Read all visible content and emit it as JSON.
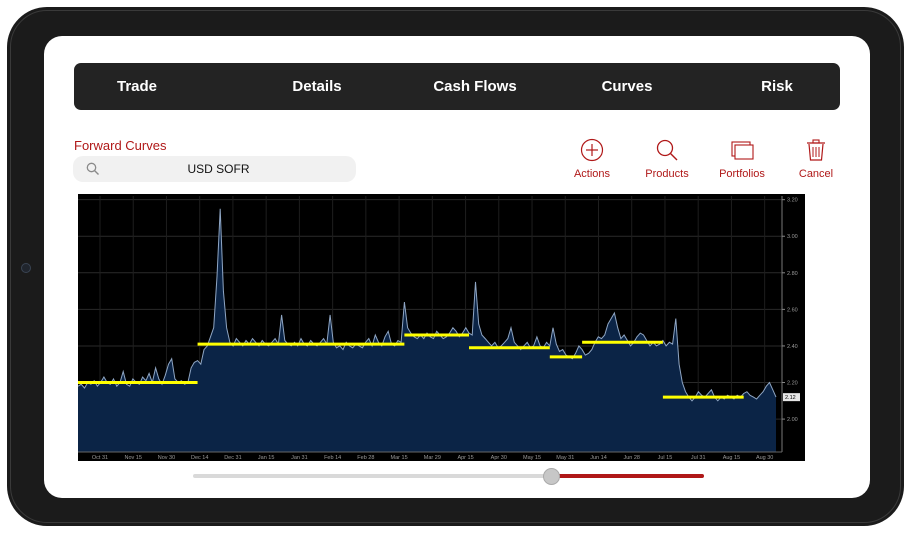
{
  "tabs": [
    {
      "label": "Trade"
    },
    {
      "label": "Details"
    },
    {
      "label": "Cash Flows"
    },
    {
      "label": "Curves"
    },
    {
      "label": "Risk"
    }
  ],
  "section": {
    "title": "Forward Curves"
  },
  "search": {
    "value": "USD SOFR",
    "icon": "search-icon"
  },
  "actions": [
    {
      "label": "Actions",
      "icon": "plus-circle-icon"
    },
    {
      "label": "Products",
      "icon": "magnifier-icon"
    },
    {
      "label": "Portfolios",
      "icon": "folders-icon"
    },
    {
      "label": "Cancel",
      "icon": "trash-icon"
    }
  ],
  "colors": {
    "accent": "#b01818",
    "tabbar": "#232323",
    "chart_bg": "#000000",
    "area_fill": "#0b2446",
    "step_line": "#ffff00"
  },
  "slider": {
    "value_fraction": 0.7
  },
  "chart_data": {
    "type": "area",
    "title": "",
    "xlabel": "",
    "ylabel": "",
    "ylim": [
      1.82,
      3.22
    ],
    "grid": true,
    "x_ticks": [
      "Oct 31",
      "Nov 15",
      "Nov 30",
      "Dec 14",
      "Dec 31",
      "Jan 15",
      "Jan 31",
      "Feb 14",
      "Feb 28",
      "Mar 15",
      "Mar 29",
      "Apr 15",
      "Apr 30",
      "May 15",
      "May 31",
      "Jun 14",
      "Jun 28",
      "Jul 15",
      "Jul 31",
      "Aug 15",
      "Aug 30"
    ],
    "y_ticks": [
      "2.00",
      "2.20",
      "2.40",
      "2.60",
      "2.80",
      "3.00",
      "3.20"
    ],
    "last_value_label": "2.12",
    "series": [
      {
        "values": [
          2.18,
          2.19,
          2.17,
          2.2,
          2.19,
          2.21,
          2.18,
          2.2,
          2.23,
          2.2,
          2.19,
          2.22,
          2.18,
          2.2,
          2.26,
          2.19,
          2.18,
          2.22,
          2.2,
          2.19,
          2.23,
          2.21,
          2.25,
          2.2,
          2.28,
          2.22,
          2.19,
          2.24,
          2.3,
          2.33,
          2.22,
          2.2,
          2.21,
          2.19,
          2.2,
          2.28,
          2.31,
          2.32,
          2.3,
          2.38,
          2.4,
          2.45,
          2.5,
          2.78,
          3.15,
          2.7,
          2.5,
          2.42,
          2.4,
          2.44,
          2.42,
          2.4,
          2.43,
          2.41,
          2.44,
          2.42,
          2.4,
          2.43,
          2.41,
          2.4,
          2.42,
          2.44,
          2.41,
          2.57,
          2.43,
          2.41,
          2.4,
          2.42,
          2.4,
          2.44,
          2.41,
          2.4,
          2.43,
          2.41,
          2.4,
          2.42,
          2.44,
          2.41,
          2.57,
          2.42,
          2.39,
          2.4,
          2.38,
          2.42,
          2.4,
          2.39,
          2.41,
          2.4,
          2.39,
          2.42,
          2.44,
          2.4,
          2.46,
          2.42,
          2.4,
          2.45,
          2.48,
          2.41,
          2.4,
          2.43,
          2.42,
          2.64,
          2.5,
          2.47,
          2.45,
          2.44,
          2.46,
          2.44,
          2.47,
          2.45,
          2.44,
          2.48,
          2.46,
          2.44,
          2.45,
          2.47,
          2.5,
          2.48,
          2.45,
          2.47,
          2.5,
          2.47,
          2.46,
          2.75,
          2.52,
          2.46,
          2.44,
          2.42,
          2.4,
          2.42,
          2.39,
          2.4,
          2.42,
          2.44,
          2.5,
          2.42,
          2.4,
          2.38,
          2.4,
          2.42,
          2.39,
          2.4,
          2.45,
          2.4,
          2.39,
          2.42,
          2.4,
          2.5,
          2.41,
          2.37,
          2.38,
          2.35,
          2.34,
          2.33,
          2.36,
          2.4,
          2.38,
          2.35,
          2.36,
          2.38,
          2.42,
          2.45,
          2.44,
          2.46,
          2.52,
          2.55,
          2.58,
          2.5,
          2.44,
          2.46,
          2.43,
          2.4,
          2.42,
          2.45,
          2.47,
          2.46,
          2.43,
          2.4,
          2.42,
          2.4,
          2.41,
          2.43,
          2.4,
          2.42,
          2.41,
          2.55,
          2.3,
          2.2,
          2.15,
          2.12,
          2.1,
          2.12,
          2.15,
          2.13,
          2.12,
          2.14,
          2.16,
          2.12,
          2.1,
          2.12,
          2.11,
          2.13,
          2.12,
          2.11,
          2.13,
          2.12,
          2.14,
          2.15,
          2.13,
          2.12,
          2.11,
          2.13,
          2.15,
          2.18,
          2.2,
          2.16,
          2.12
        ]
      }
    ],
    "steps": [
      {
        "x_from": 0,
        "x_to": 37,
        "value": 2.2
      },
      {
        "x_from": 37,
        "x_to": 101,
        "value": 2.41
      },
      {
        "x_from": 101,
        "x_to": 121,
        "value": 2.46
      },
      {
        "x_from": 121,
        "x_to": 146,
        "value": 2.39
      },
      {
        "x_from": 146,
        "x_to": 156,
        "value": 2.34
      },
      {
        "x_from": 156,
        "x_to": 181,
        "value": 2.42
      },
      {
        "x_from": 181,
        "x_to": 206,
        "value": 2.12
      }
    ]
  }
}
